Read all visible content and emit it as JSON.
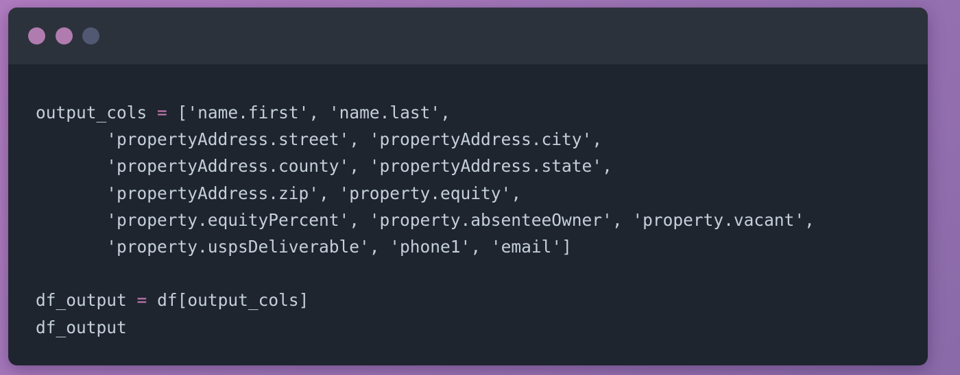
{
  "window": {
    "controls": [
      {
        "name": "close",
        "color": "#b07cb0"
      },
      {
        "name": "minimize",
        "color": "#b07cb0"
      },
      {
        "name": "maximize",
        "color": "#505872"
      }
    ]
  },
  "code": {
    "lines": [
      [
        {
          "t": "output_cols",
          "c": "id"
        },
        {
          "t": " ",
          "c": "ws"
        },
        {
          "t": "=",
          "c": "op"
        },
        {
          "t": " [",
          "c": "punc"
        },
        {
          "t": "'name.first'",
          "c": "str"
        },
        {
          "t": ", ",
          "c": "punc"
        },
        {
          "t": "'name.last'",
          "c": "str"
        },
        {
          "t": ",",
          "c": "punc"
        }
      ],
      [
        {
          "t": "       ",
          "c": "ws"
        },
        {
          "t": "'propertyAddress.street'",
          "c": "str"
        },
        {
          "t": ", ",
          "c": "punc"
        },
        {
          "t": "'propertyAddress.city'",
          "c": "str"
        },
        {
          "t": ",",
          "c": "punc"
        }
      ],
      [
        {
          "t": "       ",
          "c": "ws"
        },
        {
          "t": "'propertyAddress.county'",
          "c": "str"
        },
        {
          "t": ", ",
          "c": "punc"
        },
        {
          "t": "'propertyAddress.state'",
          "c": "str"
        },
        {
          "t": ",",
          "c": "punc"
        }
      ],
      [
        {
          "t": "       ",
          "c": "ws"
        },
        {
          "t": "'propertyAddress.zip'",
          "c": "str"
        },
        {
          "t": ", ",
          "c": "punc"
        },
        {
          "t": "'property.equity'",
          "c": "str"
        },
        {
          "t": ",",
          "c": "punc"
        }
      ],
      [
        {
          "t": "       ",
          "c": "ws"
        },
        {
          "t": "'property.equityPercent'",
          "c": "str"
        },
        {
          "t": ", ",
          "c": "punc"
        },
        {
          "t": "'property.absenteeOwner'",
          "c": "str"
        },
        {
          "t": ", ",
          "c": "punc"
        },
        {
          "t": "'property.vacant'",
          "c": "str"
        },
        {
          "t": ",",
          "c": "punc"
        }
      ],
      [
        {
          "t": "       ",
          "c": "ws"
        },
        {
          "t": "'property.uspsDeliverable'",
          "c": "str"
        },
        {
          "t": ", ",
          "c": "punc"
        },
        {
          "t": "'phone1'",
          "c": "str"
        },
        {
          "t": ", ",
          "c": "punc"
        },
        {
          "t": "'email'",
          "c": "str"
        },
        {
          "t": "]",
          "c": "punc"
        }
      ],
      [],
      [
        {
          "t": "df_output",
          "c": "id"
        },
        {
          "t": " ",
          "c": "ws"
        },
        {
          "t": "=",
          "c": "op"
        },
        {
          "t": " ",
          "c": "ws"
        },
        {
          "t": "df[output_cols]",
          "c": "id"
        }
      ],
      [
        {
          "t": "df_output",
          "c": "id"
        }
      ]
    ]
  }
}
